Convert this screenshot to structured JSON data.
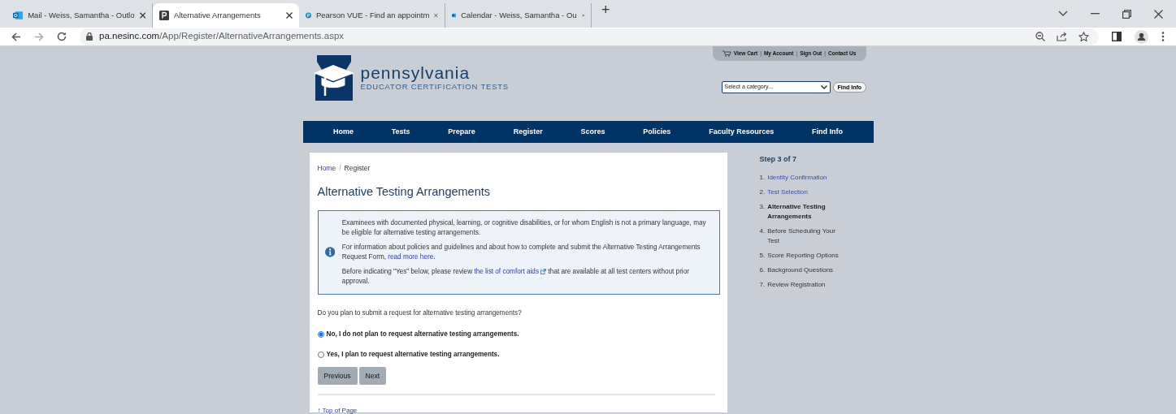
{
  "browser": {
    "tabs": [
      {
        "title": "Mail - Weiss, Samantha - Outlo",
        "selected": false
      },
      {
        "title": "Alternative Arrangements",
        "selected": true
      },
      {
        "title": "Pearson VUE - Find an appointm",
        "selected": false
      },
      {
        "title": "Calendar - Weiss, Samantha - Ou",
        "selected": false
      }
    ],
    "new_tab": "+",
    "url_host": "pa.nesinc.com",
    "url_path": "/App/Register/AlternativeArrangements.aspx"
  },
  "header": {
    "logo": {
      "name": "pennsylvania",
      "tagline": "EDUCATOR CERTIFICATION TESTS"
    },
    "utility_links": [
      "View Cart",
      "My Account",
      "Sign Out",
      "Contact Us"
    ],
    "utility_separator": "|",
    "category_select": {
      "value": "Select a category..."
    },
    "find_button": "Find Info"
  },
  "nav": [
    "Home",
    "Tests",
    "Prepare",
    "Register",
    "Scores",
    "Policies",
    "Faculty Resources",
    "Find Info"
  ],
  "breadcrumb": {
    "links": [
      "Home"
    ],
    "separator": "/",
    "current": "Register"
  },
  "title": "Alternative Testing Arrangements",
  "info_box": {
    "paragraphs": [
      {
        "text": "Examinees with documented physical, learning, or cognitive disabilities, or for whom English is not a primary language, may be eligible for alternative testing arrangements."
      },
      {
        "text": "For information about policies and guidelines and about how to complete and submit the Alternative Testing Arrangements Request Form, ",
        "link": "read more here",
        "after": "."
      },
      {
        "text": "Before indicating \"Yes\" below, please review ",
        "link": "the list of comfort aids",
        "external": true,
        "after": " that are available at all test centers without prior approval."
      }
    ]
  },
  "question": "Do you plan to submit a request for alternative testing arrangements?",
  "options": [
    {
      "label": "No, I do not plan to request alternative testing arrangements.",
      "selected": true
    },
    {
      "label": "Yes, I plan to request alternative testing arrangements.",
      "selected": false
    }
  ],
  "buttons": [
    "Previous",
    "Next"
  ],
  "top_link": {
    "arrow": "↑",
    "label": "Top of Page"
  },
  "steps": {
    "heading": "Step 3 of 7",
    "items": [
      {
        "number": "1.",
        "label": "Identity Confirmation",
        "kind": "done"
      },
      {
        "number": "2.",
        "label": "Test Selection",
        "kind": "done"
      },
      {
        "number": "3.",
        "label": "Alternative Testing Arrangements",
        "kind": "current"
      },
      {
        "number": "4.",
        "label": "Before Scheduling Your Test",
        "kind": "upcoming"
      },
      {
        "number": "5.",
        "label": "Score Reporting Options",
        "kind": "upcoming"
      },
      {
        "number": "6.",
        "label": "Background Questions",
        "kind": "upcoming"
      },
      {
        "number": "7.",
        "label": "Review Registration",
        "kind": "upcoming"
      }
    ]
  }
}
